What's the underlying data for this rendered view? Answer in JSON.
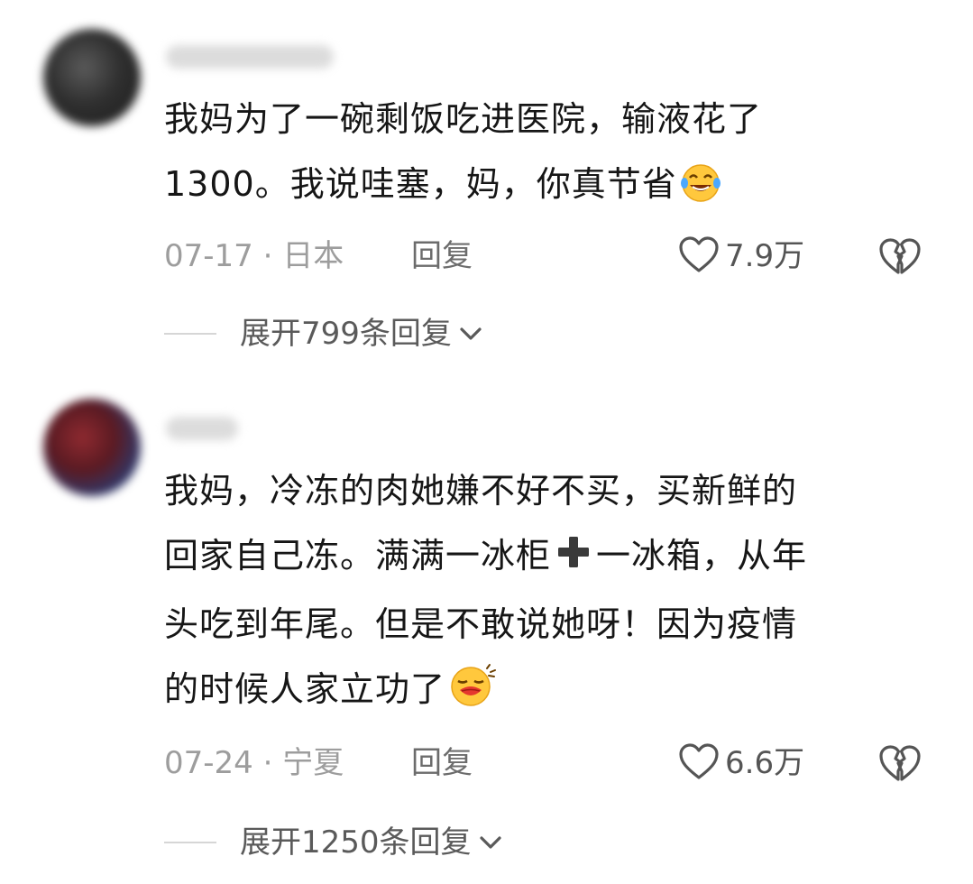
{
  "comments": [
    {
      "text": "我妈为了一碗剩饭吃进医院，输液花了\n1300。我说哇塞，妈，你真节省",
      "emoji": "laughing-crying-emoji",
      "date_location": "07-17 · 日本",
      "reply_label": "回复",
      "like_count": "7.9万",
      "expand_label": "展开799条回复"
    },
    {
      "text_part1": "我妈，冷冻的肉她嫌不好不买，买新鲜的\n回家自己冻。满满一冰柜",
      "inline_emoji": "plus-emoji",
      "text_part2": "一冰箱，从年\n头吃到年尾。但是不敢说她呀！因为疫情\n的时候人家立功了",
      "emoji": "blowing-kiss-emoji",
      "date_location": "07-24 · 宁夏",
      "reply_label": "回复",
      "like_count": "6.6万",
      "expand_label": "展开1250条回复"
    }
  ],
  "colors": {
    "text": "#161616",
    "meta": "#9d9d9d",
    "reply": "#6c6c6c",
    "expand": "#5a5a5a",
    "icon": "#555555"
  },
  "icons": {
    "like": "heart-outline-icon",
    "dislike": "broken-heart-icon",
    "expand": "chevron-down-icon"
  }
}
